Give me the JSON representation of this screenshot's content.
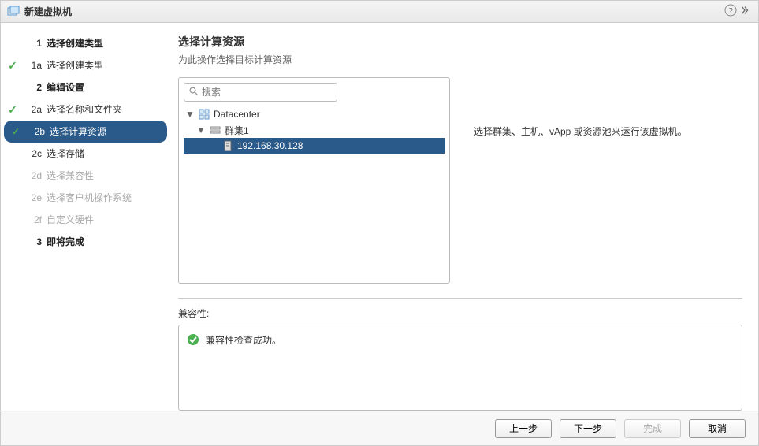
{
  "title": "新建虚拟机",
  "sidebar": {
    "items": [
      {
        "num": "1",
        "label": "选择创建类型",
        "major": true
      },
      {
        "num": "1a",
        "label": "选择创建类型",
        "check": true
      },
      {
        "num": "2",
        "label": "编辑设置",
        "major": true
      },
      {
        "num": "2a",
        "label": "选择名称和文件夹",
        "check": true
      },
      {
        "num": "2b",
        "label": "选择计算资源",
        "selected": true,
        "check": true
      },
      {
        "num": "2c",
        "label": "选择存储"
      },
      {
        "num": "2d",
        "label": "选择兼容性",
        "disabled": true
      },
      {
        "num": "2e",
        "label": "选择客户机操作系统",
        "disabled": true
      },
      {
        "num": "2f",
        "label": "自定义硬件",
        "disabled": true
      },
      {
        "num": "3",
        "label": "即将完成",
        "major": true
      }
    ]
  },
  "content": {
    "heading": "选择计算资源",
    "subtitle": "为此操作选择目标计算资源",
    "search_placeholder": "搜索",
    "help_text": "选择群集、主机、vApp 或资源池来运行该虚拟机。",
    "tree": [
      {
        "label": "Datacenter",
        "icon": "datacenter",
        "level": 0,
        "expanded": true
      },
      {
        "label": "群集1",
        "icon": "cluster",
        "level": 1,
        "expanded": true
      },
      {
        "label": "192.168.30.128",
        "icon": "host",
        "level": 2,
        "selected": true
      }
    ],
    "compat_label": "兼容性:",
    "compat_text": "兼容性检查成功。"
  },
  "buttons": {
    "back": "上一步",
    "next": "下一步",
    "finish": "完成",
    "cancel": "取消"
  },
  "icons": {
    "vm": "#5b9bd5",
    "search": "Q"
  }
}
